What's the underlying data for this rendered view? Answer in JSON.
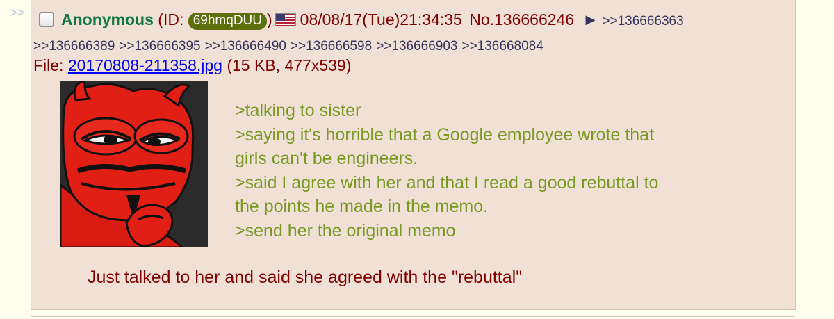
{
  "thread": {
    "side_arrows": ">>"
  },
  "post": {
    "name": "Anonymous",
    "id_prefix": "(ID: ",
    "id": "69hmqDUU",
    "id_suffix": ")",
    "flag_country": "United States",
    "datetime": "08/08/17(Tue)21:34:35",
    "number": "No.136666246",
    "menu_arrow": "▶",
    "backlinks": [
      ">>136666363",
      ">>136666389",
      ">>136666395",
      ">>136666490",
      ">>136666598",
      ">>136666903",
      ">>136668084"
    ],
    "file": {
      "prefix": "File: ",
      "name": "20170808-211358.jpg",
      "meta": " (15 KB, 477x539)"
    },
    "greentext": [
      ">talking to sister",
      ">saying it's horrible that a Google employee wrote that",
      "girls can't be engineers.",
      ">said I agree with her and that I read a good rebuttal to",
      "the points he made in the memo.",
      ">send her the original memo"
    ],
    "text": "Just talked to her and said she agreed with the \"rebuttal\""
  },
  "colors": {
    "background": "#ffffee",
    "reply_background": "#f0e0d6",
    "name": "#117743",
    "greentext": "#789922",
    "text": "#800000",
    "link": "#34345c",
    "file_link": "#0000ee",
    "id_badge": "#5c6f0b"
  }
}
